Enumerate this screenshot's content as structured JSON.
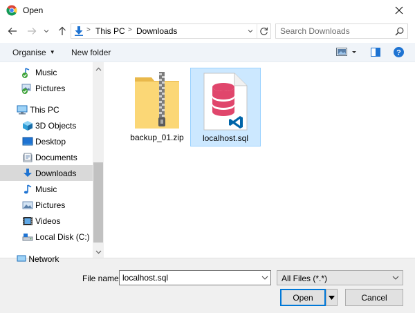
{
  "window": {
    "title": "Open",
    "app_icon": "chrome-icon",
    "close_icon": "close-icon"
  },
  "navigation": {
    "back_icon": "back-arrow-icon",
    "forward_icon": "forward-arrow-icon",
    "recent_icon": "chevron-down-icon",
    "up_icon": "up-arrow-icon",
    "breadcrumbs": [
      "This PC",
      "Downloads"
    ],
    "refresh_icon": "refresh-icon",
    "search_placeholder": "Search Downloads"
  },
  "commands": {
    "organise": "Organise",
    "new_folder": "New folder",
    "view_icon": "view-options-icon",
    "preview_icon": "preview-pane-icon",
    "help_icon": "help-icon"
  },
  "sidebar": {
    "items": [
      {
        "label": "Music",
        "icon": "music-folder-synced-icon"
      },
      {
        "label": "Pictures",
        "icon": "pictures-folder-synced-icon"
      },
      {
        "label": "This PC",
        "icon": "computer-icon"
      },
      {
        "label": "3D Objects",
        "icon": "3d-objects-icon"
      },
      {
        "label": "Desktop",
        "icon": "desktop-icon"
      },
      {
        "label": "Documents",
        "icon": "documents-icon"
      },
      {
        "label": "Downloads",
        "icon": "downloads-icon"
      },
      {
        "label": "Music",
        "icon": "music-icon"
      },
      {
        "label": "Pictures",
        "icon": "pictures-icon"
      },
      {
        "label": "Videos",
        "icon": "videos-icon"
      },
      {
        "label": "Local Disk (C:)",
        "icon": "local-disk-icon"
      }
    ],
    "partial_item": "Network"
  },
  "files": [
    {
      "name": "backup_01.zip",
      "icon": "zip-folder-icon",
      "selected": false
    },
    {
      "name": "localhost.sql",
      "icon": "sql-file-icon",
      "selected": true
    }
  ],
  "footer": {
    "filename_label": "File name:",
    "filename_value": "localhost.sql",
    "filetype_value": "All Files (*.*)",
    "open_label": "Open",
    "cancel_label": "Cancel"
  },
  "colors": {
    "selection": "#cce8ff",
    "accent": "#0078d7",
    "sql_icon": "#e0466c",
    "vscode_badge": "#0065a9"
  }
}
